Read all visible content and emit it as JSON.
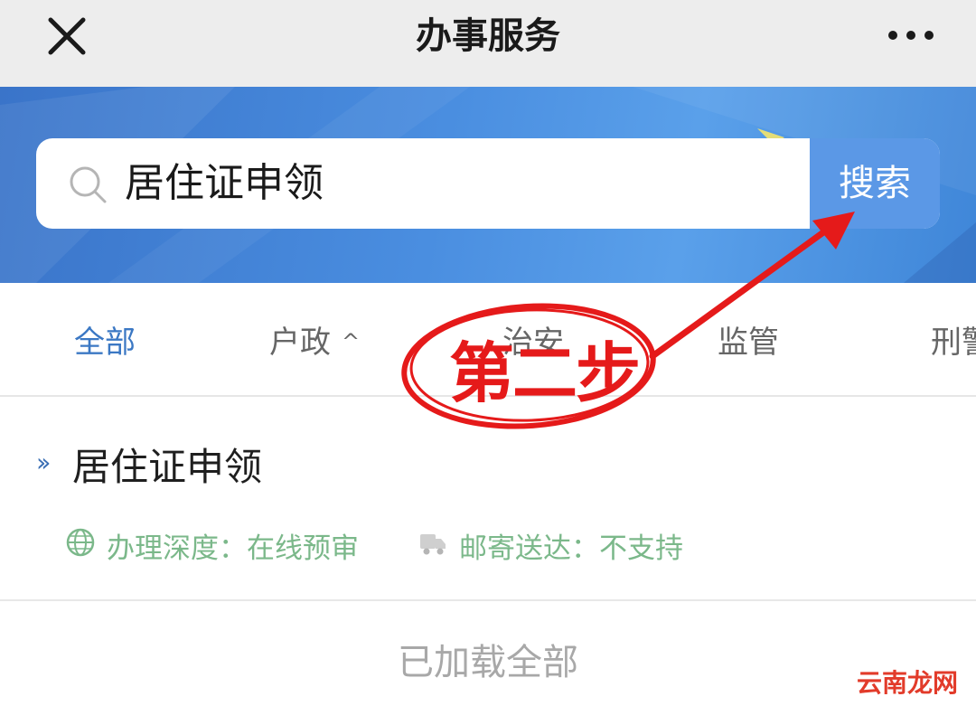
{
  "header": {
    "title": "办事服务",
    "close_icon": "close-icon",
    "more_icon": "more-icon"
  },
  "search": {
    "value": "居住证申领",
    "button_label": "搜索",
    "icon": "search-icon"
  },
  "tabs": [
    {
      "label": "全部",
      "active": true
    },
    {
      "label": "户政",
      "caret": "^"
    },
    {
      "label": "治安"
    },
    {
      "label": "监管"
    },
    {
      "label": "刑警"
    }
  ],
  "results": [
    {
      "title": "居住证申领",
      "depth_label": "办理深度：在线预审",
      "mail_label": "邮寄送达：不支持"
    }
  ],
  "footer": {
    "status": "已加载全部"
  },
  "annotation": {
    "text": "第二步"
  },
  "watermark": {
    "text": "云南龙网"
  },
  "colors": {
    "accent": "#3b78c4",
    "search_button": "#5b98e6",
    "meta_green": "#7bb88a",
    "annotation_red": "#e51a1a"
  }
}
